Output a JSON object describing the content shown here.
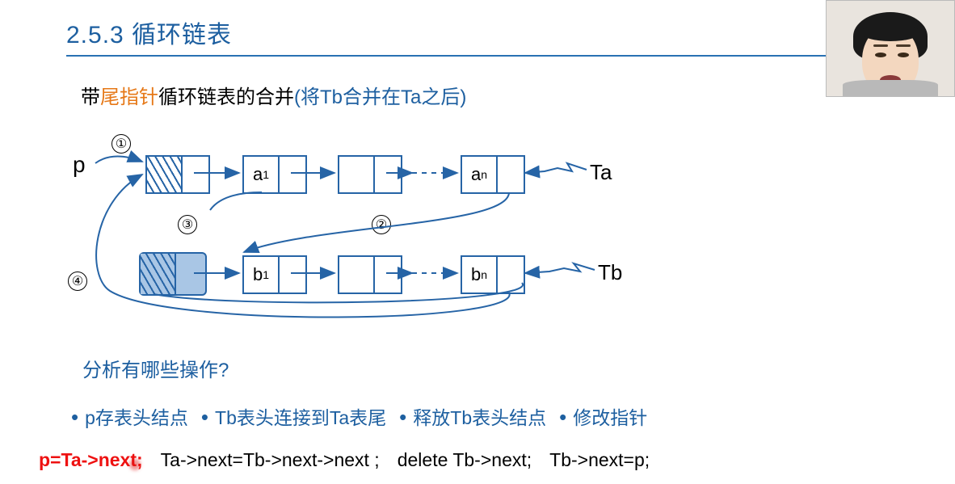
{
  "title": "2.5.3 循环链表",
  "subtitle": {
    "pre": "带",
    "hi": "尾指针",
    "mid": "循环链表的合并",
    "paren": "(将Tb合并在Ta之后)"
  },
  "diagram": {
    "p": "p",
    "circles": {
      "c1": "①",
      "c2": "②",
      "c3": "③",
      "c4": "④"
    },
    "nodes": {
      "a1": "a",
      "a1sub": "1",
      "an": "a",
      "ansub": "n",
      "b1": "b",
      "b1sub": "1",
      "bn": "b",
      "bnsub": "n"
    },
    "ellipsis": "...",
    "labels": {
      "ta": "Ta",
      "tb": "Tb"
    }
  },
  "question": "分析有哪些操作?",
  "ops": {
    "o1": "p存表头结点",
    "o2": "Tb表头连接到Ta表尾",
    "o3": "释放Tb表头结点",
    "o4": "修改指针"
  },
  "code": {
    "c1": "p=Ta->next;",
    "c2": "Ta->next=Tb->next->next  ;",
    "c3": "delete Tb->next;",
    "c4": "Tb->next=p;"
  },
  "watermark": ""
}
